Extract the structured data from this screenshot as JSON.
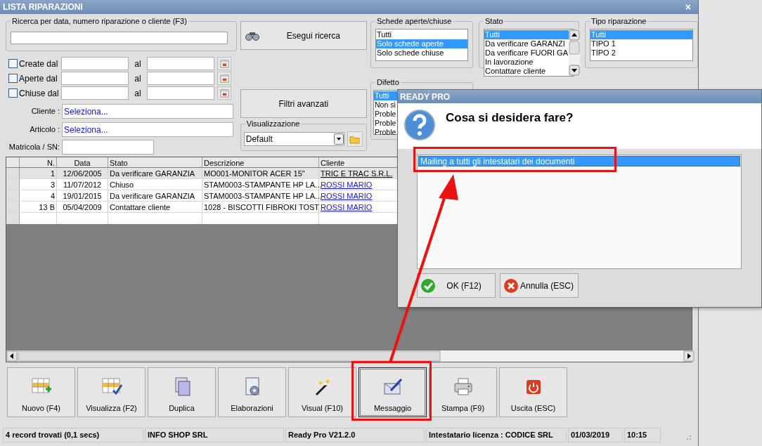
{
  "window": {
    "title": "LISTA RIPARAZIONI",
    "close": "×"
  },
  "search": {
    "legend": "Ricerca per data, numero riparazione o cliente (F3)"
  },
  "date_filters": [
    {
      "label": "Create dal",
      "checked": false,
      "to_label": "al"
    },
    {
      "label": "Aperte dal",
      "checked": false,
      "to_label": "al"
    },
    {
      "label": "Chiuse dal",
      "checked": false,
      "to_label": "al"
    }
  ],
  "cliente": {
    "label": "Cliente :",
    "value": "Seleziona..."
  },
  "articolo": {
    "label": "Articolo :",
    "value": "Seleziona..."
  },
  "matricola": {
    "label": "Matricola / SN:"
  },
  "search_button": "Esegui ricerca",
  "advanced_button": "Filtri avanzati",
  "view": {
    "legend": "Visualizzazione",
    "value": "Default"
  },
  "filter_lists": [
    {
      "legend": "Schede aperte/chiuse",
      "scrollbar": false,
      "items": [
        {
          "label": "Tutti",
          "selected": false
        },
        {
          "label": "Solo schede aperte",
          "selected": true
        },
        {
          "label": "Solo schede chiuse",
          "selected": false
        }
      ]
    },
    {
      "legend": "Stato",
      "scrollbar": true,
      "items": [
        {
          "label": "Tutti",
          "selected": true
        },
        {
          "label": "Da verificare GARANZI",
          "selected": false
        },
        {
          "label": "Da verificare FUORI GA",
          "selected": false
        },
        {
          "label": "In lavorazione",
          "selected": false
        },
        {
          "label": "Contattare cliente",
          "selected": false
        }
      ]
    },
    {
      "legend": "Tipo riparazione",
      "scrollbar": false,
      "items": [
        {
          "label": "Tutti",
          "selected": true
        },
        {
          "label": "TIPO 1",
          "selected": false
        },
        {
          "label": "TIPO 2",
          "selected": false
        }
      ]
    }
  ],
  "defect_list": {
    "legend": "Difetto",
    "items": [
      {
        "label": "Tutti",
        "selected": true
      },
      {
        "label": "Non si",
        "selected": false
      },
      {
        "label": "Proble",
        "selected": false
      },
      {
        "label": "Proble",
        "selected": false
      },
      {
        "label": "Proble",
        "selected": false
      }
    ]
  },
  "table": {
    "columns": [
      "N.",
      "Data",
      "Stato",
      "Descrizione",
      "Cliente"
    ],
    "rows": [
      {
        "cells": [
          "1",
          "12/06/2005",
          "Da verificare GARANZIA",
          "MO001-MONITOR ACER 15\"",
          "TRIC E TRAC S.R.L."
        ],
        "selected": true
      },
      {
        "cells": [
          "3",
          "11/07/2012",
          "Chiuso",
          "STAM0003-STAMPANTE HP LA...",
          "ROSSI MARIO"
        ],
        "selected": false
      },
      {
        "cells": [
          "4",
          "19/01/2015",
          "Da verificare GARANZIA",
          "STAM0003-STAMPANTE HP LA...",
          "ROSSI MARIO"
        ],
        "selected": false
      },
      {
        "cells": [
          "13 B",
          "05/04/2009",
          "Contattare cliente",
          "1028 - BISCOTTI FIBROKI TOST",
          "ROSSI MARIO"
        ],
        "selected": false
      }
    ]
  },
  "toolbar": [
    {
      "label": "Nuovo (F4)",
      "kind": "new",
      "selected": false
    },
    {
      "label": "Visualizza (F2)",
      "kind": "view",
      "selected": false
    },
    {
      "label": "Duplica",
      "kind": "duplicate",
      "selected": false
    },
    {
      "label": "Elaborazioni",
      "kind": "process",
      "selected": false
    },
    {
      "label": "Visual (F10)",
      "kind": "wand",
      "selected": false
    },
    {
      "label": "Messaggio",
      "kind": "message",
      "selected": true
    },
    {
      "label": "Stampa (F9)",
      "kind": "print",
      "selected": false
    },
    {
      "label": "Uscita (ESC)",
      "kind": "exit",
      "selected": false
    }
  ],
  "status_bar": [
    "4 record trovati (0,1 secs)",
    "INFO SHOP SRL",
    "Ready Pro V21.2.0",
    "Intestatario licenza : CODICE SRL",
    "01/03/2019",
    "10:15"
  ],
  "dialog": {
    "title": "READY PRO",
    "question": "Cosa si desidera fare?",
    "options": [
      {
        "label": "Mailing a tutti gli intestatari dei documenti",
        "selected": true
      }
    ],
    "buttons": [
      {
        "label": "OK (F12)",
        "kind": "ok"
      },
      {
        "label": "Annulla (ESC)",
        "kind": "cancel"
      }
    ]
  }
}
